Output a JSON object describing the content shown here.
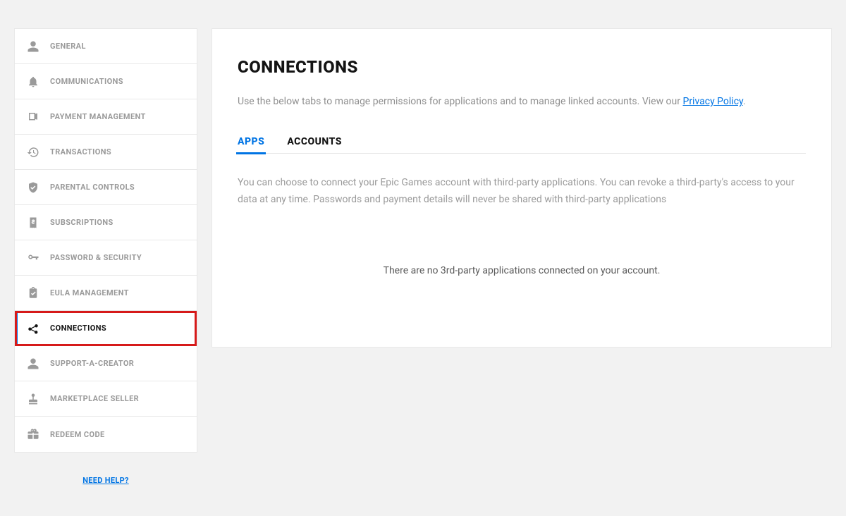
{
  "sidebar": {
    "items": [
      {
        "label": "GENERAL"
      },
      {
        "label": "COMMUNICATIONS"
      },
      {
        "label": "PAYMENT MANAGEMENT"
      },
      {
        "label": "TRANSACTIONS"
      },
      {
        "label": "PARENTAL CONTROLS"
      },
      {
        "label": "SUBSCRIPTIONS"
      },
      {
        "label": "PASSWORD & SECURITY"
      },
      {
        "label": "EULA MANAGEMENT"
      },
      {
        "label": "CONNECTIONS"
      },
      {
        "label": "SUPPORT-A-CREATOR"
      },
      {
        "label": "MARKETPLACE SELLER"
      },
      {
        "label": "REDEEM CODE"
      }
    ],
    "help": "NEED HELP?"
  },
  "main": {
    "title": "CONNECTIONS",
    "desc_prefix": "Use the below tabs to manage permissions for applications and to manage linked accounts. View our ",
    "privacy_link": "Privacy Policy",
    "desc_suffix": ".",
    "tabs": [
      {
        "label": "APPS"
      },
      {
        "label": "ACCOUNTS"
      }
    ],
    "sub_desc": "You can choose to connect your Epic Games account with third-party applications. You can revoke a third-party's access to your data at any time. Passwords and payment details will never be shared with third-party applications",
    "empty": "There are no 3rd-party applications connected on your account."
  }
}
